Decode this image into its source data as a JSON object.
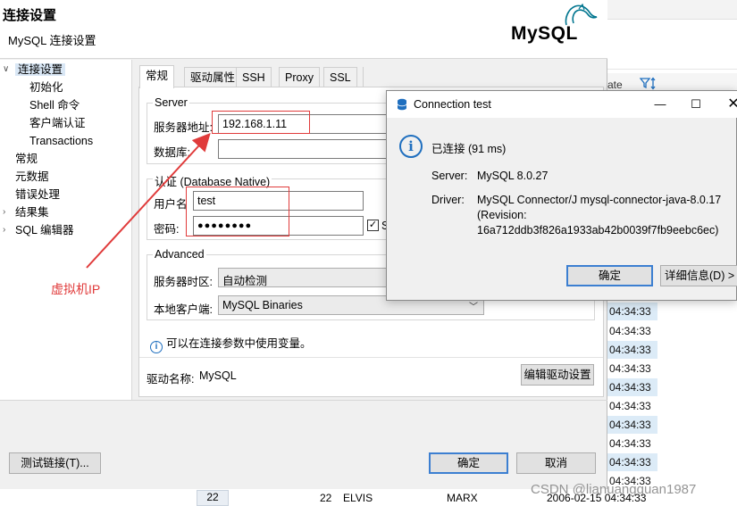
{
  "main_dialog": {
    "title": "连接设置",
    "subtitle": "MySQL 连接设置",
    "logo_text": "MySQL",
    "tree": [
      {
        "label": "连接设置",
        "level": 0,
        "expanded": true,
        "selected": true
      },
      {
        "label": "初始化",
        "level": 1
      },
      {
        "label": "Shell 命令",
        "level": 1
      },
      {
        "label": "客户端认证",
        "level": 1
      },
      {
        "label": "Transactions",
        "level": 1
      },
      {
        "label": "常规",
        "level": 0
      },
      {
        "label": "元数据",
        "level": 0
      },
      {
        "label": "错误处理",
        "level": 0
      },
      {
        "label": "结果集",
        "level": 0,
        "collapsed": true
      },
      {
        "label": "SQL 编辑器",
        "level": 0,
        "collapsed": true
      }
    ],
    "tabs": [
      "常规",
      "驱动属性",
      "SSH",
      "Proxy",
      "SSL"
    ],
    "server_group": {
      "title": "Server",
      "host_label": "服务器地址:",
      "host_value": "192.168.1.11",
      "db_label": "数据库:",
      "db_value": ""
    },
    "auth_group": {
      "title": "认证 (Database Native)",
      "user_label": "用户名",
      "user_value": "test",
      "password_label": "密码:",
      "password_value": "●●●●●●●●",
      "save_checkbox_label": "S"
    },
    "advanced_group": {
      "title": "Advanced",
      "timezone_label": "服务器时区:",
      "timezone_value": "自动检测",
      "client_label": "本地客户端:",
      "client_value": "MySQL Binaries"
    },
    "info_text": "可以在连接参数中使用变量。",
    "driver_label": "驱动名称:",
    "driver_value": "MySQL",
    "edit_driver_button": "编辑驱动设置",
    "test_button": "测试链接(T)...",
    "ok_button": "确定",
    "cancel_button": "取消"
  },
  "annotation": {
    "text": "虚拟机IP",
    "color": "#e03b3b"
  },
  "connection_test": {
    "title": "Connection test",
    "status": "已连接 (91 ms)",
    "server_label": "Server:",
    "server_value": "MySQL 8.0.27",
    "driver_label": "Driver:",
    "driver_line1": "MySQL Connector/J mysql-connector-java-8.0.17",
    "driver_line2": "(Revision:",
    "driver_line3": "16a712ddb3f826a1933ab42b0039f7fb9eebc6ec)",
    "ok_button": "确定",
    "details_button": "详细信息(D) > >"
  },
  "background_app": {
    "header_fragment": "ate",
    "times": [
      "04:34:33",
      "04:34:33",
      "04:34:33",
      "04:34:33",
      "04:34:33",
      "04:34:33",
      "04:34:33",
      "04:34:33",
      "04:34:33",
      "04:34:33"
    ],
    "bottom_row": {
      "row_num": "22",
      "id": "22",
      "first_name": "ELVIS",
      "last_name": "MARX",
      "last_update": "2006-02-15 04:34:33"
    },
    "watermark": "CSDN @lianuangquan1987"
  },
  "colors": {
    "accent": "#3c7fd1",
    "annotation_red": "#e03b3b",
    "selection": "#d9e7f5"
  }
}
